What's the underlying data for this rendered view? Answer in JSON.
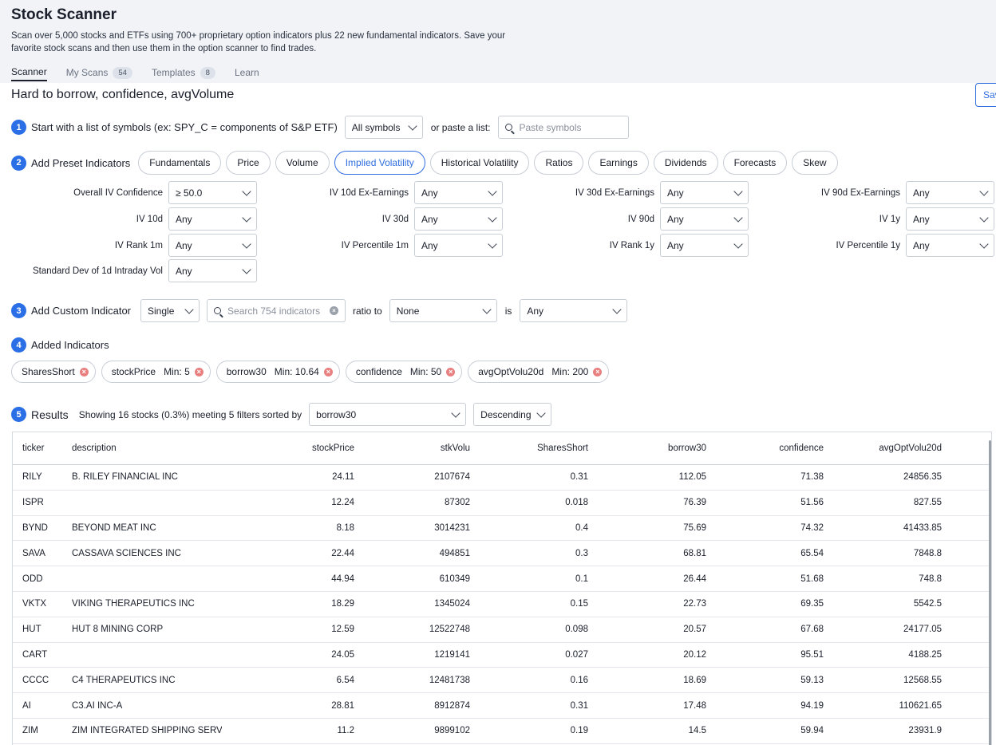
{
  "header": {
    "title": "Stock Scanner",
    "subtitle": "Scan over 5,000 stocks and ETFs using 700+ proprietary option indicators plus 22 new fundamental indicators. Save your favorite stock scans and then use them in the option scanner to find trades.",
    "tabs": [
      {
        "label": "Scanner",
        "badge": ""
      },
      {
        "label": "My Scans",
        "badge": "54"
      },
      {
        "label": "Templates",
        "badge": "8"
      },
      {
        "label": "Learn",
        "badge": ""
      }
    ]
  },
  "scan_title": "Hard to borrow, confidence, avgVolume",
  "save_label": "Sav",
  "step1": {
    "num": "1",
    "label": "Start with a list of symbols (ex: SPY_C = components of S&P ETF)",
    "symbols_value": "All symbols",
    "or_label": "or paste a list:",
    "paste_placeholder": "Paste symbols"
  },
  "step2": {
    "num": "2",
    "label": "Add Preset Indicators",
    "pills": [
      "Fundamentals",
      "Price",
      "Volume",
      "Implied Volatility",
      "Historical Volatility",
      "Ratios",
      "Earnings",
      "Dividends",
      "Forecasts",
      "Skew"
    ],
    "filters": [
      {
        "label": "Overall IV Confidence",
        "value": "≥ 50.0"
      },
      {
        "label": "IV 10d Ex-Earnings",
        "value": "Any"
      },
      {
        "label": "IV 30d Ex-Earnings",
        "value": "Any"
      },
      {
        "label": "IV 90d Ex-Earnings",
        "value": "Any"
      },
      {
        "label": "IV 10d",
        "value": "Any"
      },
      {
        "label": "IV 30d",
        "value": "Any"
      },
      {
        "label": "IV 90d",
        "value": "Any"
      },
      {
        "label": "IV 1y",
        "value": "Any"
      },
      {
        "label": "IV Rank 1m",
        "value": "Any"
      },
      {
        "label": "IV Percentile 1m",
        "value": "Any"
      },
      {
        "label": "IV Rank 1y",
        "value": "Any"
      },
      {
        "label": "IV Percentile 1y",
        "value": "Any"
      },
      {
        "label": "Standard Dev of 1d Intraday Vol",
        "value": "Any"
      }
    ]
  },
  "step3": {
    "num": "3",
    "label": "Add Custom Indicator",
    "mode": "Single",
    "search_placeholder": "Search 754 indicators",
    "ratio_label": "ratio to",
    "ratio_value": "None",
    "is_label": "is",
    "is_value": "Any"
  },
  "step4": {
    "num": "4",
    "label": "Added Indicators",
    "chips": [
      {
        "name": "SharesShort",
        "min": ""
      },
      {
        "name": "stockPrice",
        "min": "Min: 5"
      },
      {
        "name": "borrow30",
        "min": "Min: 10.64"
      },
      {
        "name": "confidence",
        "min": "Min: 50"
      },
      {
        "name": "avgOptVolu20d",
        "min": "Min: 200"
      }
    ]
  },
  "step5": {
    "num": "5",
    "label": "Results",
    "summary": "Showing 16 stocks (0.3%) meeting 5 filters sorted by",
    "sort_field": "borrow30",
    "sort_order": "Descending"
  },
  "table": {
    "columns": [
      "ticker",
      "description",
      "stockPrice",
      "stkVolu",
      "SharesShort",
      "borrow30",
      "confidence",
      "avgOptVolu20d"
    ],
    "rows": [
      [
        "RILY",
        "B. RILEY FINANCIAL INC",
        "24.11",
        "2107674",
        "0.31",
        "112.05",
        "71.38",
        "24856.35"
      ],
      [
        "ISPR",
        "",
        "12.24",
        "87302",
        "0.018",
        "76.39",
        "51.56",
        "827.55"
      ],
      [
        "BYND",
        "BEYOND MEAT INC",
        "8.18",
        "3014231",
        "0.4",
        "75.69",
        "74.32",
        "41433.85"
      ],
      [
        "SAVA",
        "CASSAVA SCIENCES INC",
        "22.44",
        "494851",
        "0.3",
        "68.81",
        "65.54",
        "7848.8"
      ],
      [
        "ODD",
        "",
        "44.94",
        "610349",
        "0.1",
        "26.44",
        "51.68",
        "748.8"
      ],
      [
        "VKTX",
        "VIKING THERAPEUTICS INC",
        "18.29",
        "1345024",
        "0.15",
        "22.73",
        "69.35",
        "5542.5"
      ],
      [
        "HUT",
        "HUT 8 MINING CORP",
        "12.59",
        "12522748",
        "0.098",
        "20.57",
        "67.68",
        "24177.05"
      ],
      [
        "CART",
        "",
        "24.05",
        "1219141",
        "0.027",
        "20.12",
        "95.51",
        "4188.25"
      ],
      [
        "CCCC",
        "C4 THERAPEUTICS INC",
        "6.54",
        "12481738",
        "0.16",
        "18.69",
        "59.13",
        "12568.55"
      ],
      [
        "AI",
        "C3.AI INC-A",
        "28.81",
        "8912874",
        "0.31",
        "17.48",
        "94.19",
        "110621.65"
      ],
      [
        "ZIM",
        "ZIM INTEGRATED SHIPPING SERV",
        "11.2",
        "9899102",
        "0.19",
        "14.5",
        "59.94",
        "23931.9"
      ],
      [
        "",
        "",
        "",
        "",
        "",
        "",
        "",
        ""
      ]
    ]
  }
}
